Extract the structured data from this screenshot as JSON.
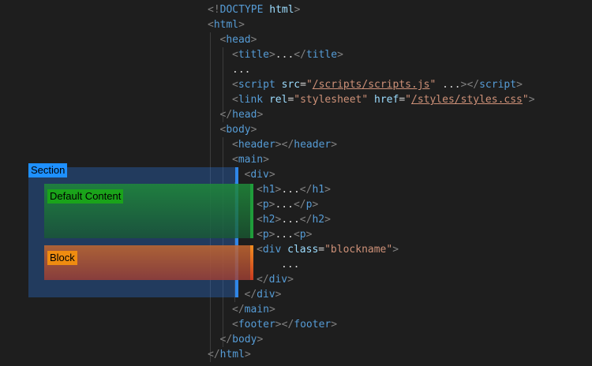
{
  "code": [
    {
      "indent": 0,
      "tokens": [
        {
          "t": "<!",
          "c": "punct"
        },
        {
          "t": "DOCTYPE",
          "c": "tag"
        },
        {
          "t": " ",
          "c": "text"
        },
        {
          "t": "html",
          "c": "attr"
        },
        {
          "t": ">",
          "c": "punct"
        }
      ]
    },
    {
      "indent": 0,
      "tokens": [
        {
          "t": "<",
          "c": "punct"
        },
        {
          "t": "html",
          "c": "tag"
        },
        {
          "t": ">",
          "c": "punct"
        }
      ]
    },
    {
      "indent": 1,
      "tokens": [
        {
          "t": "<",
          "c": "punct"
        },
        {
          "t": "head",
          "c": "tag"
        },
        {
          "t": ">",
          "c": "punct"
        }
      ]
    },
    {
      "indent": 2,
      "tokens": [
        {
          "t": "<",
          "c": "punct"
        },
        {
          "t": "title",
          "c": "tag"
        },
        {
          "t": ">",
          "c": "punct"
        },
        {
          "t": "...",
          "c": "text"
        },
        {
          "t": "</",
          "c": "punct"
        },
        {
          "t": "title",
          "c": "tag"
        },
        {
          "t": ">",
          "c": "punct"
        }
      ]
    },
    {
      "indent": 2,
      "tokens": [
        {
          "t": "...",
          "c": "text"
        }
      ]
    },
    {
      "indent": 2,
      "tokens": [
        {
          "t": "<",
          "c": "punct"
        },
        {
          "t": "script",
          "c": "tag"
        },
        {
          "t": " ",
          "c": "text"
        },
        {
          "t": "src",
          "c": "attr"
        },
        {
          "t": "=",
          "c": "eq"
        },
        {
          "t": "\"",
          "c": "str"
        },
        {
          "t": "/scripts/scripts.js",
          "c": "link"
        },
        {
          "t": "\"",
          "c": "str"
        },
        {
          "t": " ...",
          "c": "text"
        },
        {
          "t": "></",
          "c": "punct"
        },
        {
          "t": "script",
          "c": "tag"
        },
        {
          "t": ">",
          "c": "punct"
        }
      ]
    },
    {
      "indent": 2,
      "tokens": [
        {
          "t": "<",
          "c": "punct"
        },
        {
          "t": "link",
          "c": "tag"
        },
        {
          "t": " ",
          "c": "text"
        },
        {
          "t": "rel",
          "c": "attr"
        },
        {
          "t": "=",
          "c": "eq"
        },
        {
          "t": "\"stylesheet\"",
          "c": "str"
        },
        {
          "t": " ",
          "c": "text"
        },
        {
          "t": "href",
          "c": "attr"
        },
        {
          "t": "=",
          "c": "eq"
        },
        {
          "t": "\"",
          "c": "str"
        },
        {
          "t": "/styles/styles.css",
          "c": "link"
        },
        {
          "t": "\"",
          "c": "str"
        },
        {
          "t": ">",
          "c": "punct"
        }
      ]
    },
    {
      "indent": 1,
      "tokens": [
        {
          "t": "</",
          "c": "punct"
        },
        {
          "t": "head",
          "c": "tag"
        },
        {
          "t": ">",
          "c": "punct"
        }
      ]
    },
    {
      "indent": 1,
      "tokens": [
        {
          "t": "<",
          "c": "punct"
        },
        {
          "t": "body",
          "c": "tag"
        },
        {
          "t": ">",
          "c": "punct"
        }
      ]
    },
    {
      "indent": 2,
      "tokens": [
        {
          "t": "<",
          "c": "punct"
        },
        {
          "t": "header",
          "c": "tag"
        },
        {
          "t": "></",
          "c": "punct"
        },
        {
          "t": "header",
          "c": "tag"
        },
        {
          "t": ">",
          "c": "punct"
        }
      ]
    },
    {
      "indent": 2,
      "tokens": [
        {
          "t": "<",
          "c": "punct"
        },
        {
          "t": "main",
          "c": "tag"
        },
        {
          "t": ">",
          "c": "punct"
        }
      ]
    },
    {
      "indent": 3,
      "tokens": [
        {
          "t": "<",
          "c": "punct"
        },
        {
          "t": "div",
          "c": "tag"
        },
        {
          "t": ">",
          "c": "punct"
        }
      ]
    },
    {
      "indent": 4,
      "tokens": [
        {
          "t": "<",
          "c": "punct"
        },
        {
          "t": "h1",
          "c": "tag"
        },
        {
          "t": ">",
          "c": "punct"
        },
        {
          "t": "...",
          "c": "text"
        },
        {
          "t": "</",
          "c": "punct"
        },
        {
          "t": "h1",
          "c": "tag"
        },
        {
          "t": ">",
          "c": "punct"
        }
      ]
    },
    {
      "indent": 4,
      "tokens": [
        {
          "t": "<",
          "c": "punct"
        },
        {
          "t": "p",
          "c": "tag"
        },
        {
          "t": ">",
          "c": "punct"
        },
        {
          "t": "...",
          "c": "text"
        },
        {
          "t": "</",
          "c": "punct"
        },
        {
          "t": "p",
          "c": "tag"
        },
        {
          "t": ">",
          "c": "punct"
        }
      ]
    },
    {
      "indent": 4,
      "tokens": [
        {
          "t": "<",
          "c": "punct"
        },
        {
          "t": "h2",
          "c": "tag"
        },
        {
          "t": ">",
          "c": "punct"
        },
        {
          "t": "...",
          "c": "text"
        },
        {
          "t": "</",
          "c": "punct"
        },
        {
          "t": "h2",
          "c": "tag"
        },
        {
          "t": ">",
          "c": "punct"
        }
      ]
    },
    {
      "indent": 4,
      "tokens": [
        {
          "t": "<",
          "c": "punct"
        },
        {
          "t": "p",
          "c": "tag"
        },
        {
          "t": ">",
          "c": "punct"
        },
        {
          "t": "...",
          "c": "text"
        },
        {
          "t": "<",
          "c": "punct"
        },
        {
          "t": "p",
          "c": "tag"
        },
        {
          "t": ">",
          "c": "punct"
        }
      ]
    },
    {
      "indent": 4,
      "tokens": [
        {
          "t": "<",
          "c": "punct"
        },
        {
          "t": "div",
          "c": "tag"
        },
        {
          "t": " ",
          "c": "text"
        },
        {
          "t": "class",
          "c": "attr"
        },
        {
          "t": "=",
          "c": "eq"
        },
        {
          "t": "\"blockname\"",
          "c": "str"
        },
        {
          "t": ">",
          "c": "punct"
        }
      ]
    },
    {
      "indent": 6,
      "tokens": [
        {
          "t": "...",
          "c": "text"
        }
      ]
    },
    {
      "indent": 4,
      "tokens": [
        {
          "t": "</",
          "c": "punct"
        },
        {
          "t": "div",
          "c": "tag"
        },
        {
          "t": ">",
          "c": "punct"
        }
      ]
    },
    {
      "indent": 3,
      "tokens": [
        {
          "t": "</",
          "c": "punct"
        },
        {
          "t": "div",
          "c": "tag"
        },
        {
          "t": ">",
          "c": "punct"
        }
      ]
    },
    {
      "indent": 2,
      "tokens": [
        {
          "t": "</",
          "c": "punct"
        },
        {
          "t": "main",
          "c": "tag"
        },
        {
          "t": ">",
          "c": "punct"
        }
      ]
    },
    {
      "indent": 2,
      "tokens": [
        {
          "t": "<",
          "c": "punct"
        },
        {
          "t": "footer",
          "c": "tag"
        },
        {
          "t": "></",
          "c": "punct"
        },
        {
          "t": "footer",
          "c": "tag"
        },
        {
          "t": ">",
          "c": "punct"
        }
      ]
    },
    {
      "indent": 1,
      "tokens": [
        {
          "t": "</",
          "c": "punct"
        },
        {
          "t": "body",
          "c": "tag"
        },
        {
          "t": ">",
          "c": "punct"
        }
      ]
    },
    {
      "indent": 0,
      "tokens": [
        {
          "t": "</",
          "c": "punct"
        },
        {
          "t": "html",
          "c": "tag"
        },
        {
          "t": ">",
          "c": "punct"
        }
      ]
    }
  ],
  "annotations": {
    "section": {
      "label": "Section",
      "color": "#2a72d8",
      "label_bg": "#1e90ff"
    },
    "default_content": {
      "label": "Default Content",
      "color": "#1f8a3a",
      "label_bg": "#1aa31a"
    },
    "block": {
      "label": "Block",
      "color": "#d4601a",
      "label_bg": "#ef8c10"
    }
  }
}
